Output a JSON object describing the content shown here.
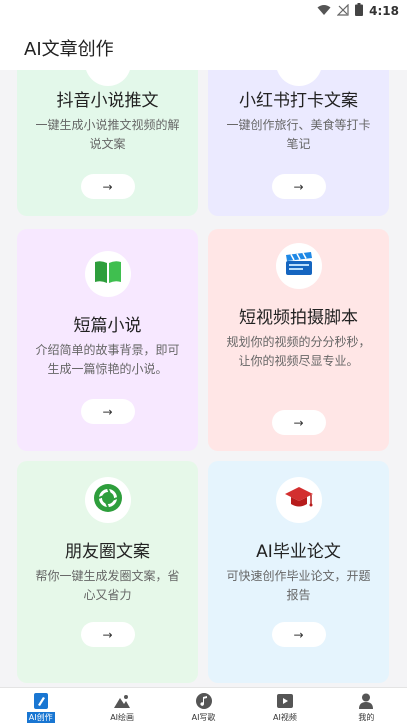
{
  "status": {
    "time": "4:18"
  },
  "appbar": {
    "title": "AI文章创作"
  },
  "cards": [
    {
      "title": "抖音小说推文",
      "desc": "一键生成小说推文视频的解说文案",
      "go": "→",
      "bg": "#e3f8ea"
    },
    {
      "title": "小红书打卡文案",
      "desc": "一键创作旅行、美食等打卡笔记",
      "go": "→",
      "bg": "#ebeaff"
    },
    {
      "title": "短篇小说",
      "desc": "介绍简单的故事背景，即可生成一篇惊艳的小说。",
      "go": "→",
      "bg": "#f7e8ff",
      "icon": "green-book-icon"
    },
    {
      "title": "短视频拍摄脚本",
      "desc": "规划你的视频的分分秒秒，让你的视频尽显专业。",
      "go": "→",
      "bg": "#ffe6e6",
      "icon": "clapperboard-icon"
    },
    {
      "title": "朋友圈文案",
      "desc": "帮你一键生成发圈文案，省心又省力",
      "go": "→",
      "bg": "#e6f8e9",
      "icon": "camera-aperture-icon"
    },
    {
      "title": "AI毕业论文",
      "desc": "可快速创作毕业论文，开题报告",
      "go": "→",
      "bg": "#e5f4fd",
      "icon": "graduation-cap-icon"
    }
  ],
  "nav": [
    {
      "label": "AI创作",
      "icon": "pen-icon",
      "active": true
    },
    {
      "label": "AI绘画",
      "icon": "picture-icon"
    },
    {
      "label": "AI写歌",
      "icon": "music-icon"
    },
    {
      "label": "AI视频",
      "icon": "video-icon"
    },
    {
      "label": "我的",
      "icon": "person-icon"
    }
  ],
  "colors": {
    "accent": "#1976d2"
  }
}
